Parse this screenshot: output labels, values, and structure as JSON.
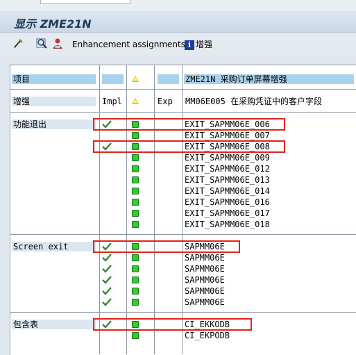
{
  "window": {
    "title": "显示 ZME21N"
  },
  "toolbar": {
    "items": [
      {
        "icon": "glasses-icon"
      },
      {
        "icon": "search-icon"
      },
      {
        "icon": "user-icon"
      },
      {
        "label": "Enhancement assignments"
      },
      {
        "icon": "info-icon",
        "label": "增强"
      }
    ]
  },
  "table": {
    "header": {
      "label": "项目",
      "name_value": "ZME21N   采购订单屏幕增强"
    },
    "subheader": {
      "label": "增强",
      "impl": "Impl",
      "exp": "Exp",
      "value": "MM06E005 在采购凭证中的客户字段"
    },
    "groups": [
      {
        "label": "功能退出",
        "rows": [
          {
            "name": "EXIT_SAPMM06E_006",
            "impl": true,
            "highlight": true
          },
          {
            "name": "EXIT_SAPMM06E_007",
            "impl": false,
            "highlight": false
          },
          {
            "name": "EXIT_SAPMM06E_008",
            "impl": true,
            "highlight": true
          },
          {
            "name": "EXIT_SAPMM06E_009",
            "impl": false,
            "highlight": false
          },
          {
            "name": "EXIT_SAPMM06E_012",
            "impl": false,
            "highlight": false
          },
          {
            "name": "EXIT_SAPMM06E_013",
            "impl": false,
            "highlight": false
          },
          {
            "name": "EXIT_SAPMM06E_014",
            "impl": false,
            "highlight": false
          },
          {
            "name": "EXIT_SAPMM06E_016",
            "impl": false,
            "highlight": false
          },
          {
            "name": "EXIT_SAPMM06E_017",
            "impl": false,
            "highlight": false
          },
          {
            "name": "EXIT_SAPMM06E_018",
            "impl": false,
            "highlight": false
          }
        ]
      },
      {
        "label": "Screen exit",
        "rows": [
          {
            "name": "SAPMM06E",
            "impl": true,
            "highlight": true
          },
          {
            "name": "SAPMM06E",
            "impl": true,
            "highlight": false
          },
          {
            "name": "SAPMM06E",
            "impl": true,
            "highlight": false
          },
          {
            "name": "SAPMM06E",
            "impl": true,
            "highlight": false
          },
          {
            "name": "SAPMM06E",
            "impl": true,
            "highlight": false
          },
          {
            "name": "SAPMM06E",
            "impl": true,
            "highlight": false
          }
        ]
      },
      {
        "label": "包含表",
        "rows": [
          {
            "name": "CI_EKKODB",
            "impl": true,
            "highlight": true
          },
          {
            "name": "CI_EKPODB",
            "impl": false,
            "highlight": false
          }
        ]
      }
    ]
  },
  "colors": {
    "highlight_box": "#e2231a",
    "status_green": "#33cc33",
    "checkmark": "#2f8a2f",
    "header_cyan": "#a9d2ee",
    "warning_triangle": "#e3c300"
  }
}
